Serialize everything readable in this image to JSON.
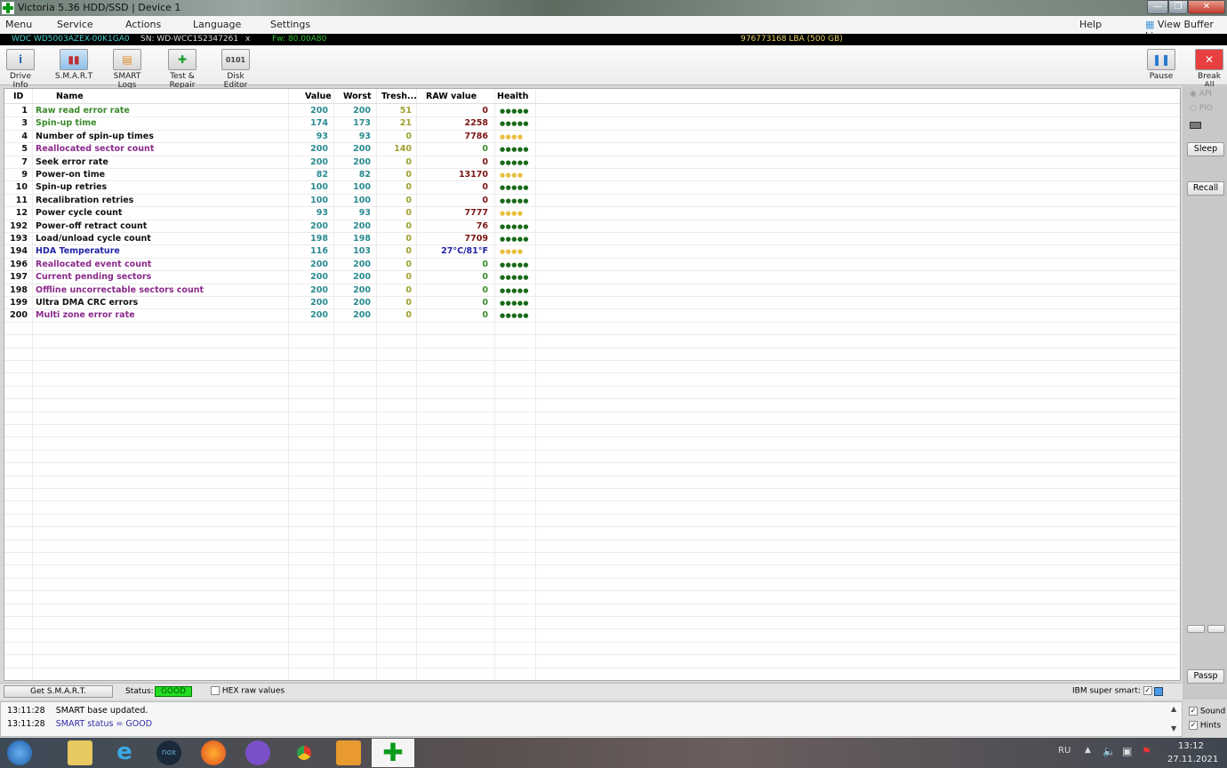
{
  "window": {
    "title": "Victoria 5.36 HDD/SSD | Device 1",
    "min": "—",
    "max": "❐",
    "close": "✕"
  },
  "menu": [
    "Menu",
    "Service",
    "Actions",
    "Language",
    "Settings"
  ],
  "menu_right": {
    "help": "Help",
    "view_buffer": "View Buffer Live"
  },
  "drive": {
    "model": "WDC WD5003AZEX-00K1GA0",
    "serial": "SN: WD-WCC1S2347261",
    "x": "x",
    "firmware": "Fw: 80.00A80",
    "lba": "976773168 LBA (500 GB)"
  },
  "toolbar": {
    "drive_info": "Drive Info",
    "smart": "S.M.A.R.T",
    "smart_logs": "SMART Logs",
    "test_repair": "Test & Repair",
    "disk_editor": "Disk Editor",
    "pause": "Pause",
    "break_all": "Break All"
  },
  "table": {
    "headers": {
      "id": "ID",
      "name": "Name",
      "value": "Value",
      "worst": "Worst",
      "tresh": "Tresh...",
      "raw": "RAW value",
      "health": "Health"
    },
    "rows": [
      {
        "id": "1",
        "name": "Raw read error rate",
        "value": "200",
        "worst": "200",
        "tresh": "51",
        "raw": "0",
        "health": "●●●●●",
        "cls": "green",
        "rawc": "red",
        "hc": "g"
      },
      {
        "id": "3",
        "name": "Spin-up time",
        "value": "174",
        "worst": "173",
        "tresh": "21",
        "raw": "2258",
        "health": "●●●●●",
        "cls": "green",
        "rawc": "red",
        "hc": "g"
      },
      {
        "id": "4",
        "name": "Number of spin-up times",
        "value": "93",
        "worst": "93",
        "tresh": "0",
        "raw": "7786",
        "health": "●●●●",
        "cls": "black",
        "rawc": "red",
        "hc": "y"
      },
      {
        "id": "5",
        "name": "Reallocated sector count",
        "value": "200",
        "worst": "200",
        "tresh": "140",
        "raw": "0",
        "health": "●●●●●",
        "cls": "purple",
        "rawc": "green",
        "hc": "g"
      },
      {
        "id": "7",
        "name": "Seek error rate",
        "value": "200",
        "worst": "200",
        "tresh": "0",
        "raw": "0",
        "health": "●●●●●",
        "cls": "black",
        "rawc": "red",
        "hc": "g"
      },
      {
        "id": "9",
        "name": "Power-on time",
        "value": "82",
        "worst": "82",
        "tresh": "0",
        "raw": "13170",
        "health": "●●●●",
        "cls": "black",
        "rawc": "red",
        "hc": "y"
      },
      {
        "id": "10",
        "name": "Spin-up retries",
        "value": "100",
        "worst": "100",
        "tresh": "0",
        "raw": "0",
        "health": "●●●●●",
        "cls": "black",
        "rawc": "red",
        "hc": "g"
      },
      {
        "id": "11",
        "name": "Recalibration retries",
        "value": "100",
        "worst": "100",
        "tresh": "0",
        "raw": "0",
        "health": "●●●●●",
        "cls": "black",
        "rawc": "red",
        "hc": "g"
      },
      {
        "id": "12",
        "name": "Power cycle count",
        "value": "93",
        "worst": "93",
        "tresh": "0",
        "raw": "7777",
        "health": "●●●●",
        "cls": "black",
        "rawc": "red",
        "hc": "y"
      },
      {
        "id": "192",
        "name": "Power-off retract count",
        "value": "200",
        "worst": "200",
        "tresh": "0",
        "raw": "76",
        "health": "●●●●●",
        "cls": "black",
        "rawc": "red",
        "hc": "g"
      },
      {
        "id": "193",
        "name": "Load/unload cycle count",
        "value": "198",
        "worst": "198",
        "tresh": "0",
        "raw": "7709",
        "health": "●●●●●",
        "cls": "black",
        "rawc": "red",
        "hc": "g"
      },
      {
        "id": "194",
        "name": "HDA Temperature",
        "value": "116",
        "worst": "103",
        "tresh": "0",
        "raw": "27°C/81°F",
        "health": "●●●●",
        "cls": "blue",
        "rawc": "blue",
        "hc": "y"
      },
      {
        "id": "196",
        "name": "Reallocated event count",
        "value": "200",
        "worst": "200",
        "tresh": "0",
        "raw": "0",
        "health": "●●●●●",
        "cls": "purple",
        "rawc": "green",
        "hc": "g"
      },
      {
        "id": "197",
        "name": "Current pending sectors",
        "value": "200",
        "worst": "200",
        "tresh": "0",
        "raw": "0",
        "health": "●●●●●",
        "cls": "purple",
        "rawc": "green",
        "hc": "g"
      },
      {
        "id": "198",
        "name": "Offline uncorrectable sectors count",
        "value": "200",
        "worst": "200",
        "tresh": "0",
        "raw": "0",
        "health": "●●●●●",
        "cls": "purple",
        "rawc": "green",
        "hc": "g"
      },
      {
        "id": "199",
        "name": "Ultra DMA CRC errors",
        "value": "200",
        "worst": "200",
        "tresh": "0",
        "raw": "0",
        "health": "●●●●●",
        "cls": "black",
        "rawc": "green",
        "hc": "g"
      },
      {
        "id": "200",
        "name": "Multi zone error rate",
        "value": "200",
        "worst": "200",
        "tresh": "0",
        "raw": "0",
        "health": "●●●●●",
        "cls": "purple",
        "rawc": "green",
        "hc": "g"
      }
    ]
  },
  "colors": {
    "green": "#3b8b2b",
    "black": "#111111",
    "purple": "#8b2a8b",
    "blue": "#2424a8",
    "red": "#7a1414",
    "teal": "#2a8a8f",
    "olive": "#a0a030",
    "health_good": "#1a6a1a",
    "health_warn": "#e8c040",
    "status_good": "#22dd22"
  },
  "right_panel": {
    "api": "API",
    "pio": "PIO",
    "sleep": "Sleep",
    "recall": "Recall",
    "passp": "Passp",
    "sound": "Sound",
    "hints": "Hints"
  },
  "status": {
    "get_smart": "Get S.M.A.R.T.",
    "status_label": "Status:",
    "status_value": "GOOD",
    "hex_raw": "HEX raw values",
    "ibm": "IBM super smart:"
  },
  "log": [
    {
      "time": "13:11:28",
      "msg": "SMART base updated."
    },
    {
      "time": "13:11:28",
      "msg": "SMART status = GOOD"
    }
  ],
  "taskbar": {
    "lang": "RU",
    "time": "13:12",
    "date": "27.11.2021"
  }
}
